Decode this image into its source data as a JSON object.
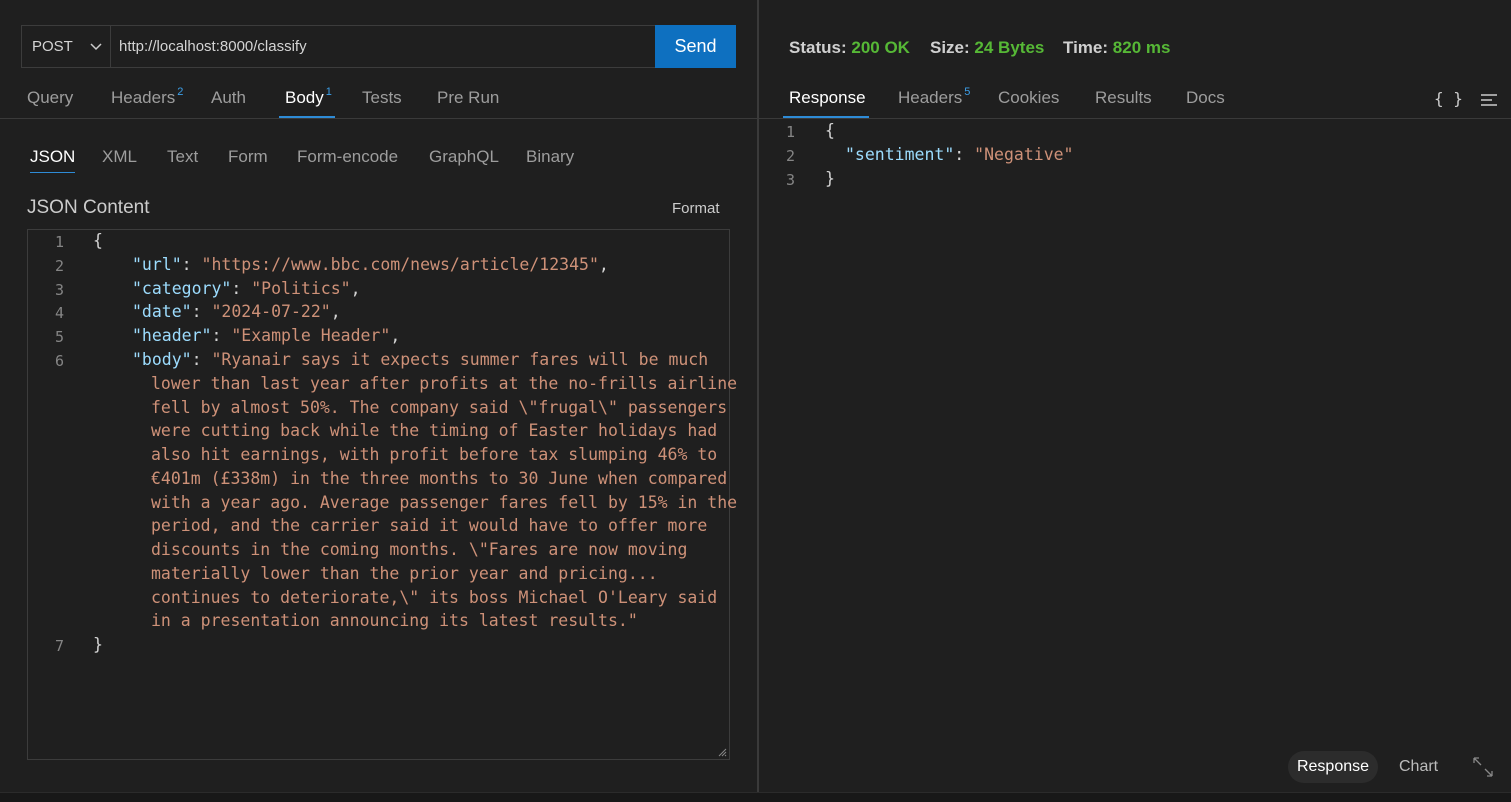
{
  "request": {
    "method": "POST",
    "url": "http://localhost:8000/classify",
    "send_label": "Send"
  },
  "request_tabs": [
    {
      "label": "Query",
      "badge": ""
    },
    {
      "label": "Headers",
      "badge": "2"
    },
    {
      "label": "Auth",
      "badge": ""
    },
    {
      "label": "Body",
      "badge": "1",
      "active": true
    },
    {
      "label": "Tests",
      "badge": ""
    },
    {
      "label": "Pre Run",
      "badge": ""
    }
  ],
  "body_tabs": [
    {
      "label": "JSON",
      "active": true
    },
    {
      "label": "XML"
    },
    {
      "label": "Text"
    },
    {
      "label": "Form"
    },
    {
      "label": "Form-encode"
    },
    {
      "label": "GraphQL"
    },
    {
      "label": "Binary"
    }
  ],
  "json_content": {
    "label": "JSON Content",
    "format_label": "Format",
    "line_numbers": [
      "1",
      "2",
      "3",
      "4",
      "5",
      "6",
      "7"
    ],
    "open_brace": "{",
    "close_brace": "}",
    "fields": [
      {
        "key": "\"url\"",
        "value": "\"https://www.bbc.com/news/article/12345\""
      },
      {
        "key": "\"category\"",
        "value": "\"Politics\""
      },
      {
        "key": "\"date\"",
        "value": "\"2024-07-22\""
      },
      {
        "key": "\"header\"",
        "value": "\"Example Header\""
      }
    ],
    "body_key": "\"body\"",
    "body_lines": [
      "\"Ryanair says it expects summer fares will be much",
      "lower than last year after profits at the no-frills airline",
      "fell by almost 50%. The company said \\\"frugal\\\" passengers",
      "were cutting back while the timing of Easter holidays had",
      "also hit earnings, with profit before tax slumping 46% to",
      "€401m (£338m) in the three months to 30 June when compared",
      "with a year ago. Average passenger fares fell by 15% in the",
      "period, and the carrier said it would have to offer more",
      "discounts in the coming months. \\\"Fares are now moving",
      "materially lower than the prior year and pricing...",
      "continues to deteriorate,\\\" its boss Michael O'Leary said",
      "in a presentation announcing its latest results.\""
    ]
  },
  "response_meta": {
    "status_label": "Status:",
    "status_value": "200 OK",
    "size_label": "Size:",
    "size_value": "24 Bytes",
    "time_label": "Time:",
    "time_value": "820 ms",
    "value_color": "#56b836"
  },
  "response_tabs": [
    {
      "label": "Response",
      "badge": "",
      "active": true
    },
    {
      "label": "Headers",
      "badge": "5"
    },
    {
      "label": "Cookies",
      "badge": ""
    },
    {
      "label": "Results",
      "badge": ""
    },
    {
      "label": "Docs",
      "badge": ""
    }
  ],
  "response_icons": {
    "braces": "{ }",
    "menu": "menu-icon"
  },
  "response_body": {
    "line_numbers": [
      "1",
      "2",
      "3"
    ],
    "open_brace": "{",
    "key": "\"sentiment\"",
    "value": "\"Negative\"",
    "close_brace": "}"
  },
  "view_switch": {
    "response_label": "Response",
    "chart_label": "Chart"
  },
  "colors": {
    "accent": "#0e70c0",
    "tab_underline": "#2e8bd6",
    "json_key": "#9cdcfe",
    "json_string": "#ce9178",
    "background": "#1f1f1f"
  }
}
